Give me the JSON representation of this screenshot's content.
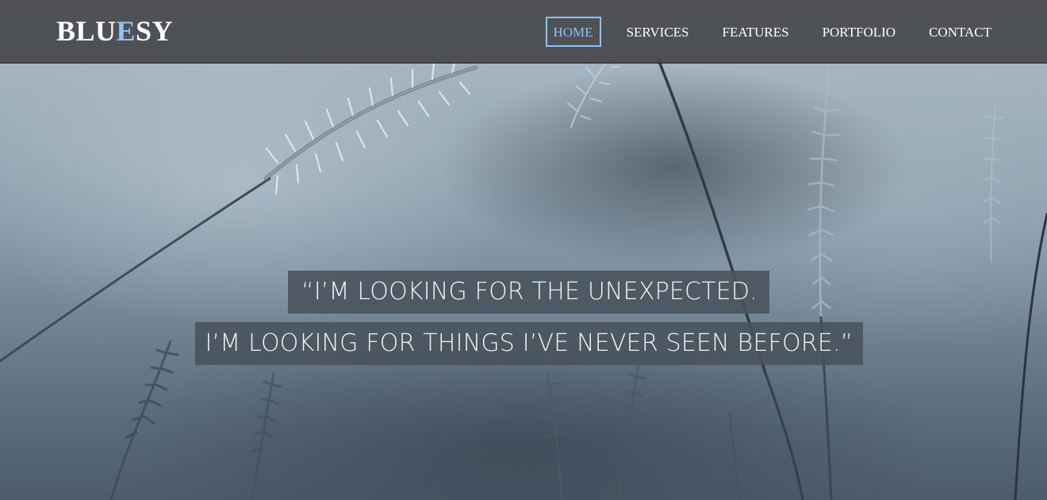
{
  "brand": {
    "logo_prefix": "BLU",
    "logo_accent": "E",
    "logo_suffix": "SY",
    "accent_color": "#8ec3f2"
  },
  "nav": {
    "items": [
      {
        "label": "HOME",
        "active": true
      },
      {
        "label": "SERVICES",
        "active": false
      },
      {
        "label": "FEATURES",
        "active": false
      },
      {
        "label": "PORTFOLIO",
        "active": false
      },
      {
        "label": "CONTACT",
        "active": false
      }
    ]
  },
  "hero": {
    "quote_line_1": "“I’M LOOKING FOR THE UNEXPECTED.",
    "quote_line_2": "I’M LOOKING FOR THINGS I’VE NEVER SEEN BEFORE.”",
    "background_image": "wheat-field-photo"
  }
}
